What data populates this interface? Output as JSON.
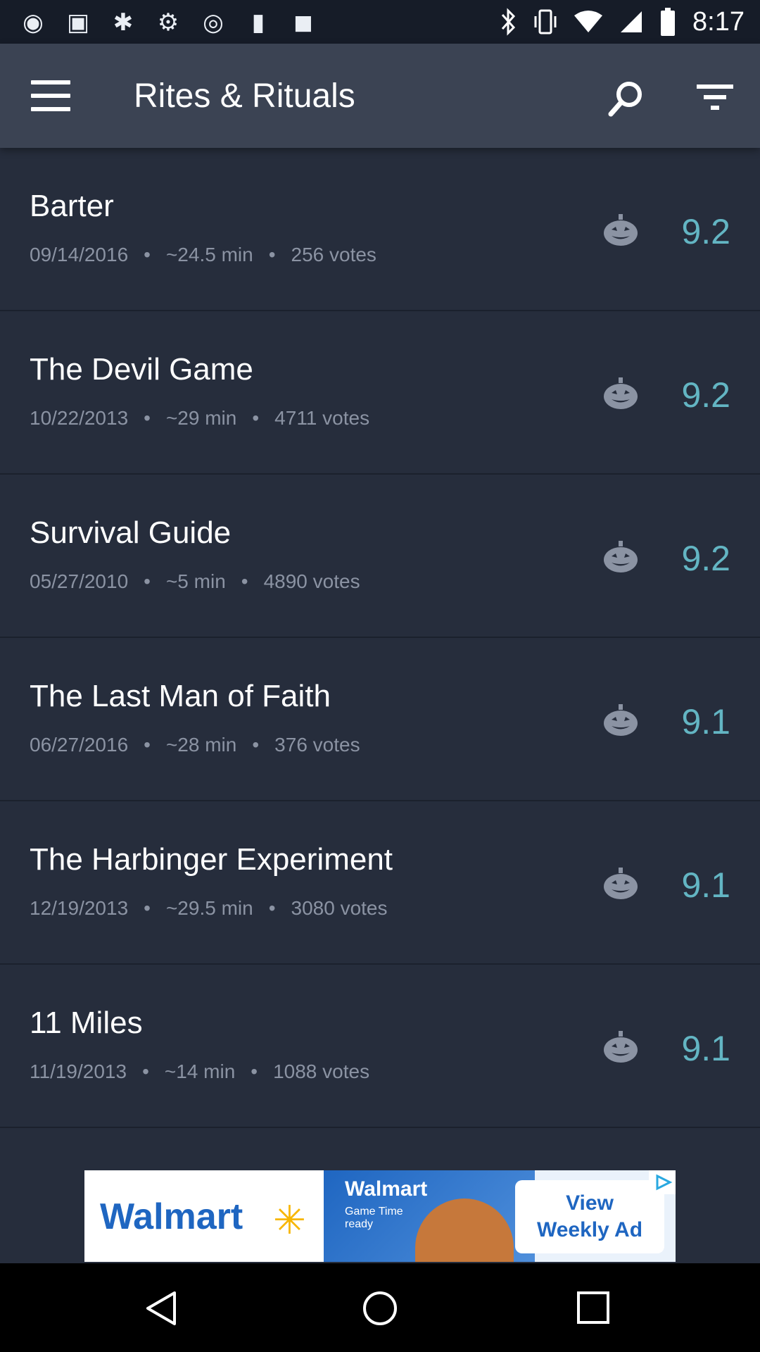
{
  "status_bar": {
    "time": "8:17",
    "left_icons": [
      "notification-dot-icon",
      "gift-icon",
      "tools-icon",
      "settings-icon",
      "lock-icon",
      "game-controller-icon"
    ],
    "right_icons": [
      "bluetooth-icon",
      "vibrate-icon",
      "wifi-icon",
      "signal-icon",
      "battery-icon"
    ]
  },
  "app_bar": {
    "title": "Rites & Rituals"
  },
  "items": [
    {
      "name": "Barter",
      "date": "09/14/2016",
      "duration": "~24.5 min",
      "votes": "256 votes",
      "rating": "9.2"
    },
    {
      "name": "The Devil Game",
      "date": "10/22/2013",
      "duration": "~29 min",
      "votes": "4711 votes",
      "rating": "9.2"
    },
    {
      "name": "Survival Guide",
      "date": "05/27/2010",
      "duration": "~5 min",
      "votes": "4890 votes",
      "rating": "9.2"
    },
    {
      "name": "The Last Man of Faith",
      "date": "06/27/2016",
      "duration": "~28 min",
      "votes": "376 votes",
      "rating": "9.1"
    },
    {
      "name": "The Harbinger Experiment",
      "date": "12/19/2013",
      "duration": "~29.5 min",
      "votes": "3080 votes",
      "rating": "9.1"
    },
    {
      "name": "11 Miles",
      "date": "11/19/2013",
      "duration": "~14 min",
      "votes": "1088 votes",
      "rating": "9.1"
    }
  ],
  "ad": {
    "brand": "Walmart",
    "mid_brand": "Walmart",
    "mid_text": "Game Time ready",
    "cta_line1": "View",
    "cta_line2": "Weekly Ad"
  },
  "colors": {
    "background": "#262d3c",
    "app_bar": "#3b4353",
    "rating": "#63b5c3",
    "meta": "#8b93a3"
  }
}
